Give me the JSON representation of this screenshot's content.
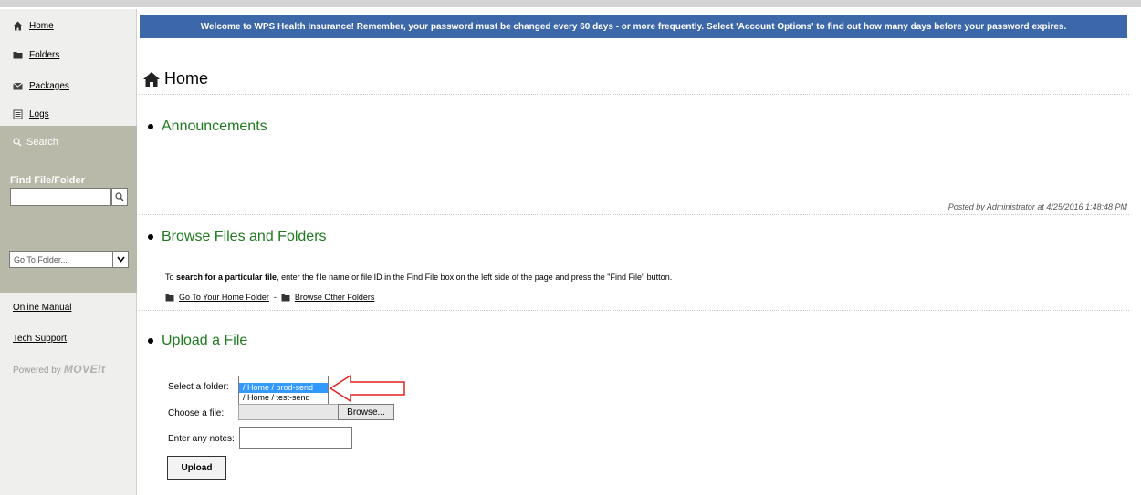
{
  "banner": "Welcome to WPS Health Insurance! Remember, your password must be changed every 60 days - or more frequently. Select 'Account Options' to find out how many days before your password expires.",
  "sidebar": {
    "nav": [
      {
        "label": "Home",
        "icon": "home-icon"
      },
      {
        "label": "Folders",
        "icon": "folder-icon"
      },
      {
        "label": "Packages",
        "icon": "package-icon"
      },
      {
        "label": "Logs",
        "icon": "logs-icon"
      }
    ],
    "search_label": "Search",
    "find_label": "Find File/Folder",
    "find_value": "",
    "goto_placeholder": "Go To Folder...",
    "online_manual": "Online Manual",
    "tech_support": "Tech Support",
    "powered_by": "Powered by",
    "powered_brand": "MOVEit"
  },
  "main": {
    "title": "Home",
    "announcements": {
      "heading": "Announcements",
      "posted": "Posted by Administrator at 4/25/2016 1:48:48 PM"
    },
    "browse": {
      "heading": "Browse Files and Folders",
      "text_prefix": "To ",
      "text_bold": "search for a particular file",
      "text_suffix": ", enter the file name or file ID in the Find File box on the left side of the page and press the \"Find File\" button.",
      "home_folder_link": "Go To Your Home Folder",
      "separator": "-",
      "other_folders_link": "Browse Other Folders"
    },
    "upload": {
      "heading": "Upload a File",
      "select_folder_label": "Select a folder:",
      "choose_file_label": "Choose a file:",
      "notes_label": "Enter any notes:",
      "folders": [
        "/ Home / prod-send",
        "/ Home / test-send"
      ],
      "selected_folder_index": 0,
      "browse_button": "Browse...",
      "notes_value": "",
      "upload_button": "Upload"
    }
  },
  "colors": {
    "banner_bg": "#3c67a9",
    "heading_green": "#1f7a1f",
    "selection_blue": "#3399ff",
    "annotation_red": "#e02020"
  }
}
